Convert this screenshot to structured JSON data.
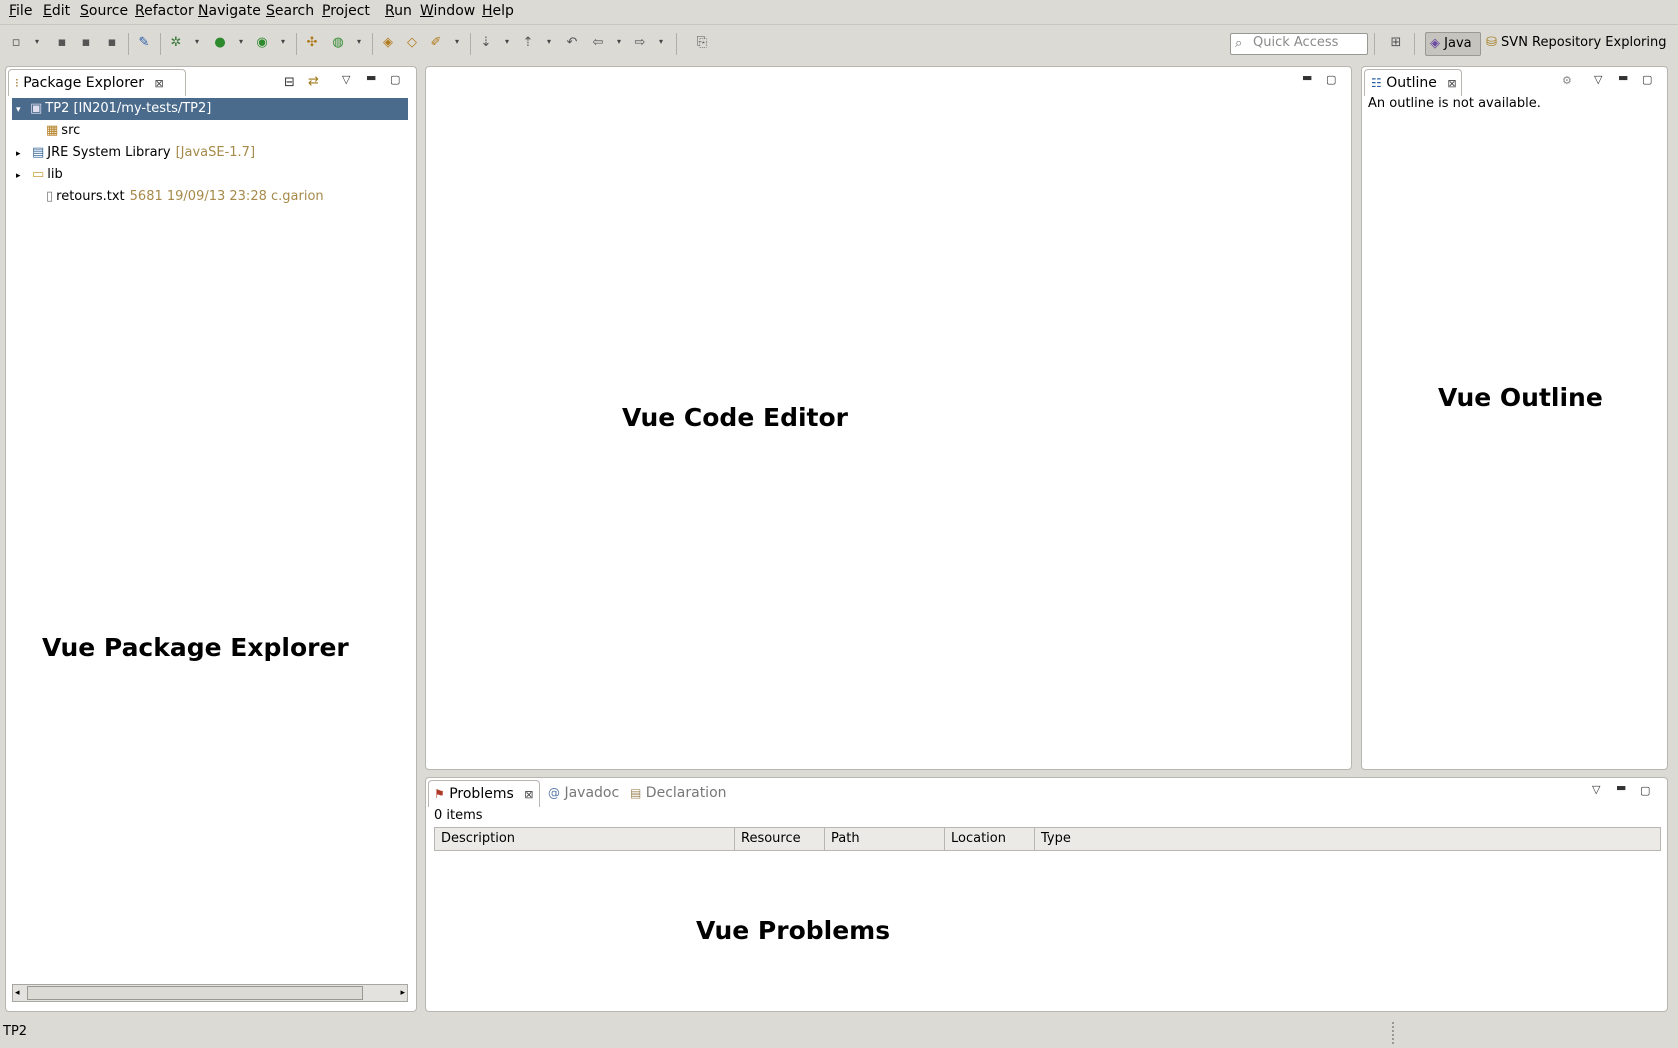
{
  "menu": [
    "File",
    "Edit",
    "Source",
    "Refactor",
    "Navigate",
    "Search",
    "Project",
    "Run",
    "Window",
    "Help"
  ],
  "menu_mnemonics": [
    "F",
    "E",
    "S",
    "R",
    "N",
    "S",
    "P",
    "R",
    "W",
    "H"
  ],
  "toolbar": {
    "quick_access_placeholder": "Quick Access",
    "perspective_java": "Java",
    "perspective_svn": "SVN Repository Exploring"
  },
  "package_explorer": {
    "tab_label": "Package Explorer",
    "tree": [
      {
        "label": "TP2 [IN201/my-tests/TP2]",
        "decoration": "",
        "icon": "project-icon",
        "expander": "expanded",
        "selected": true
      },
      {
        "label": "src",
        "decoration": "",
        "icon": "source-folder-icon",
        "expander": "",
        "selected": false
      },
      {
        "label": "JRE System Library",
        "decoration": "[JavaSE-1.7]",
        "icon": "library-icon",
        "expander": "collapsed",
        "selected": false
      },
      {
        "label": "lib",
        "decoration": "",
        "icon": "folder-icon",
        "expander": "collapsed",
        "selected": false
      },
      {
        "label": "retours.txt",
        "decoration": "5681  19/09/13 23:28  c.garion",
        "icon": "text-file-icon",
        "expander": "",
        "selected": false
      }
    ],
    "overlay_label": "Vue Package Explorer"
  },
  "editor": {
    "overlay_label": "Vue Code Editor"
  },
  "outline": {
    "tab_label": "Outline",
    "message": "An outline is not available.",
    "overlay_label": "Vue Outline"
  },
  "problems": {
    "tabs": [
      "Problems",
      "Javadoc",
      "Declaration"
    ],
    "summary": "0 items",
    "columns": [
      "Description",
      "Resource",
      "Path",
      "Location",
      "Type"
    ],
    "overlay_label": "Vue Problems"
  },
  "status": {
    "text": "TP2"
  },
  "colors": {
    "chrome": "#dcdad5",
    "selection": "#4a6b8c",
    "decoration": "#a68a4a"
  }
}
